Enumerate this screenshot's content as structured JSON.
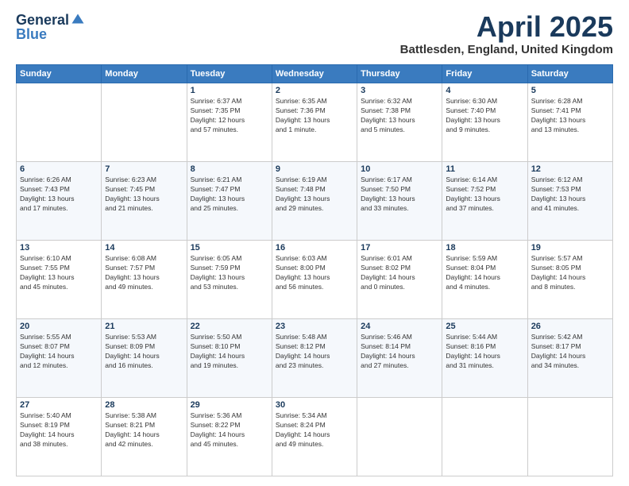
{
  "logo": {
    "general": "General",
    "blue": "Blue"
  },
  "title": {
    "month": "April 2025",
    "location": "Battlesden, England, United Kingdom"
  },
  "headers": [
    "Sunday",
    "Monday",
    "Tuesday",
    "Wednesday",
    "Thursday",
    "Friday",
    "Saturday"
  ],
  "rows": [
    [
      {
        "day": "",
        "info": ""
      },
      {
        "day": "",
        "info": ""
      },
      {
        "day": "1",
        "info": "Sunrise: 6:37 AM\nSunset: 7:35 PM\nDaylight: 12 hours\nand 57 minutes."
      },
      {
        "day": "2",
        "info": "Sunrise: 6:35 AM\nSunset: 7:36 PM\nDaylight: 13 hours\nand 1 minute."
      },
      {
        "day": "3",
        "info": "Sunrise: 6:32 AM\nSunset: 7:38 PM\nDaylight: 13 hours\nand 5 minutes."
      },
      {
        "day": "4",
        "info": "Sunrise: 6:30 AM\nSunset: 7:40 PM\nDaylight: 13 hours\nand 9 minutes."
      },
      {
        "day": "5",
        "info": "Sunrise: 6:28 AM\nSunset: 7:41 PM\nDaylight: 13 hours\nand 13 minutes."
      }
    ],
    [
      {
        "day": "6",
        "info": "Sunrise: 6:26 AM\nSunset: 7:43 PM\nDaylight: 13 hours\nand 17 minutes."
      },
      {
        "day": "7",
        "info": "Sunrise: 6:23 AM\nSunset: 7:45 PM\nDaylight: 13 hours\nand 21 minutes."
      },
      {
        "day": "8",
        "info": "Sunrise: 6:21 AM\nSunset: 7:47 PM\nDaylight: 13 hours\nand 25 minutes."
      },
      {
        "day": "9",
        "info": "Sunrise: 6:19 AM\nSunset: 7:48 PM\nDaylight: 13 hours\nand 29 minutes."
      },
      {
        "day": "10",
        "info": "Sunrise: 6:17 AM\nSunset: 7:50 PM\nDaylight: 13 hours\nand 33 minutes."
      },
      {
        "day": "11",
        "info": "Sunrise: 6:14 AM\nSunset: 7:52 PM\nDaylight: 13 hours\nand 37 minutes."
      },
      {
        "day": "12",
        "info": "Sunrise: 6:12 AM\nSunset: 7:53 PM\nDaylight: 13 hours\nand 41 minutes."
      }
    ],
    [
      {
        "day": "13",
        "info": "Sunrise: 6:10 AM\nSunset: 7:55 PM\nDaylight: 13 hours\nand 45 minutes."
      },
      {
        "day": "14",
        "info": "Sunrise: 6:08 AM\nSunset: 7:57 PM\nDaylight: 13 hours\nand 49 minutes."
      },
      {
        "day": "15",
        "info": "Sunrise: 6:05 AM\nSunset: 7:59 PM\nDaylight: 13 hours\nand 53 minutes."
      },
      {
        "day": "16",
        "info": "Sunrise: 6:03 AM\nSunset: 8:00 PM\nDaylight: 13 hours\nand 56 minutes."
      },
      {
        "day": "17",
        "info": "Sunrise: 6:01 AM\nSunset: 8:02 PM\nDaylight: 14 hours\nand 0 minutes."
      },
      {
        "day": "18",
        "info": "Sunrise: 5:59 AM\nSunset: 8:04 PM\nDaylight: 14 hours\nand 4 minutes."
      },
      {
        "day": "19",
        "info": "Sunrise: 5:57 AM\nSunset: 8:05 PM\nDaylight: 14 hours\nand 8 minutes."
      }
    ],
    [
      {
        "day": "20",
        "info": "Sunrise: 5:55 AM\nSunset: 8:07 PM\nDaylight: 14 hours\nand 12 minutes."
      },
      {
        "day": "21",
        "info": "Sunrise: 5:53 AM\nSunset: 8:09 PM\nDaylight: 14 hours\nand 16 minutes."
      },
      {
        "day": "22",
        "info": "Sunrise: 5:50 AM\nSunset: 8:10 PM\nDaylight: 14 hours\nand 19 minutes."
      },
      {
        "day": "23",
        "info": "Sunrise: 5:48 AM\nSunset: 8:12 PM\nDaylight: 14 hours\nand 23 minutes."
      },
      {
        "day": "24",
        "info": "Sunrise: 5:46 AM\nSunset: 8:14 PM\nDaylight: 14 hours\nand 27 minutes."
      },
      {
        "day": "25",
        "info": "Sunrise: 5:44 AM\nSunset: 8:16 PM\nDaylight: 14 hours\nand 31 minutes."
      },
      {
        "day": "26",
        "info": "Sunrise: 5:42 AM\nSunset: 8:17 PM\nDaylight: 14 hours\nand 34 minutes."
      }
    ],
    [
      {
        "day": "27",
        "info": "Sunrise: 5:40 AM\nSunset: 8:19 PM\nDaylight: 14 hours\nand 38 minutes."
      },
      {
        "day": "28",
        "info": "Sunrise: 5:38 AM\nSunset: 8:21 PM\nDaylight: 14 hours\nand 42 minutes."
      },
      {
        "day": "29",
        "info": "Sunrise: 5:36 AM\nSunset: 8:22 PM\nDaylight: 14 hours\nand 45 minutes."
      },
      {
        "day": "30",
        "info": "Sunrise: 5:34 AM\nSunset: 8:24 PM\nDaylight: 14 hours\nand 49 minutes."
      },
      {
        "day": "",
        "info": ""
      },
      {
        "day": "",
        "info": ""
      },
      {
        "day": "",
        "info": ""
      }
    ]
  ]
}
